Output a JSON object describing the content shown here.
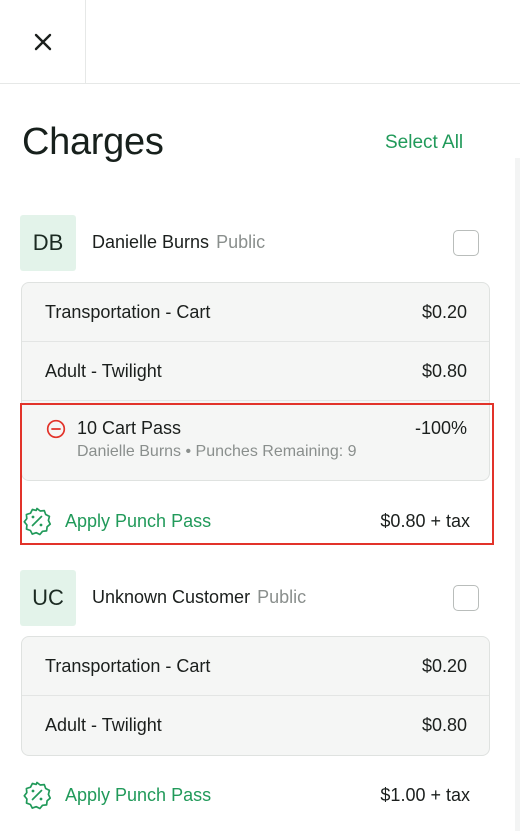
{
  "header": {
    "close_icon": "close-icon"
  },
  "title": "Charges",
  "select_all_label": "Select All",
  "colors": {
    "accent": "#219a5a",
    "avatar_bg": "#e3f3ea",
    "remove": "#e2332a",
    "highlight": "#e2332a"
  },
  "customers": [
    {
      "initials": "DB",
      "name": "Danielle Burns",
      "type": "Public",
      "checked": false,
      "charges": [
        {
          "label": "Transportation - Cart",
          "amount": "$0.20"
        },
        {
          "label": "Adult - Twilight",
          "amount": "$0.80"
        }
      ],
      "punch_pass": {
        "icon": "remove-circle-icon",
        "name": "10 Cart Pass",
        "discount": "-100%",
        "detail": "Danielle Burns • Punches Remaining: 9"
      },
      "apply": {
        "icon": "discount-badge-icon",
        "label": "Apply Punch Pass",
        "total": "$0.80 + tax"
      }
    },
    {
      "initials": "UC",
      "name": "Unknown Customer",
      "type": "Public",
      "checked": false,
      "charges": [
        {
          "label": "Transportation - Cart",
          "amount": "$0.20"
        },
        {
          "label": "Adult - Twilight",
          "amount": "$0.80"
        }
      ],
      "apply": {
        "icon": "discount-badge-icon",
        "label": "Apply Punch Pass",
        "total": "$1.00 + tax"
      }
    }
  ]
}
